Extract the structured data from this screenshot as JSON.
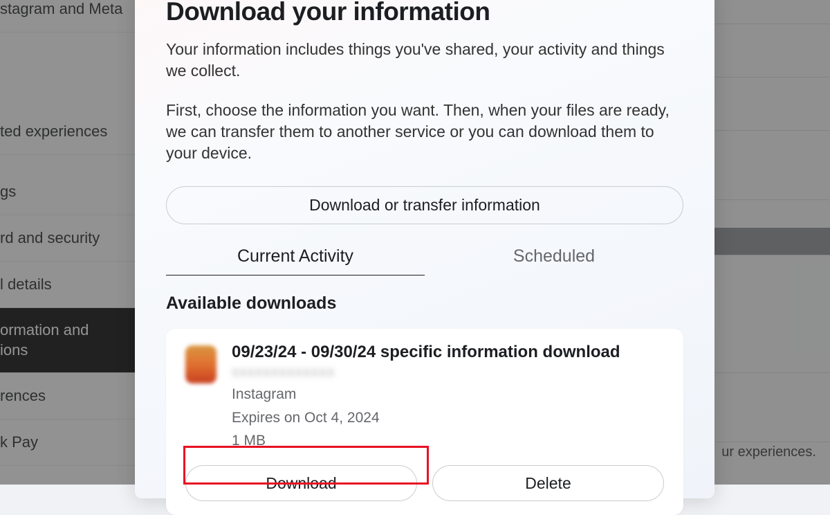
{
  "sidebar": {
    "items": [
      {
        "label": "stagram and Meta"
      },
      {
        "label": "ted experiences"
      },
      {
        "label": "gs"
      },
      {
        "label": "rd and security"
      },
      {
        "label": "l details"
      },
      {
        "label": "ormation and\nions"
      },
      {
        "label": "rences"
      },
      {
        "label": "k Pay"
      }
    ]
  },
  "right": {
    "text": "ur experiences."
  },
  "modal": {
    "title": "Download your information",
    "desc1": "Your information includes things you've shared, your activity and things we collect.",
    "desc2": "First, choose the information you want. Then, when your files are ready, we can transfer them to another service or you can download them to your device.",
    "primaryButton": "Download or transfer information",
    "tabs": [
      {
        "label": "Current Activity",
        "active": true
      },
      {
        "label": "Scheduled",
        "active": false
      }
    ],
    "sectionTitle": "Available downloads",
    "card": {
      "title": "09/23/24 - 09/30/24 specific information download",
      "username": "xxxxxxxxxxxxx",
      "platform": "Instagram",
      "expires": "Expires on Oct 4, 2024",
      "size": "1 MB",
      "downloadLabel": "Download",
      "deleteLabel": "Delete"
    }
  }
}
